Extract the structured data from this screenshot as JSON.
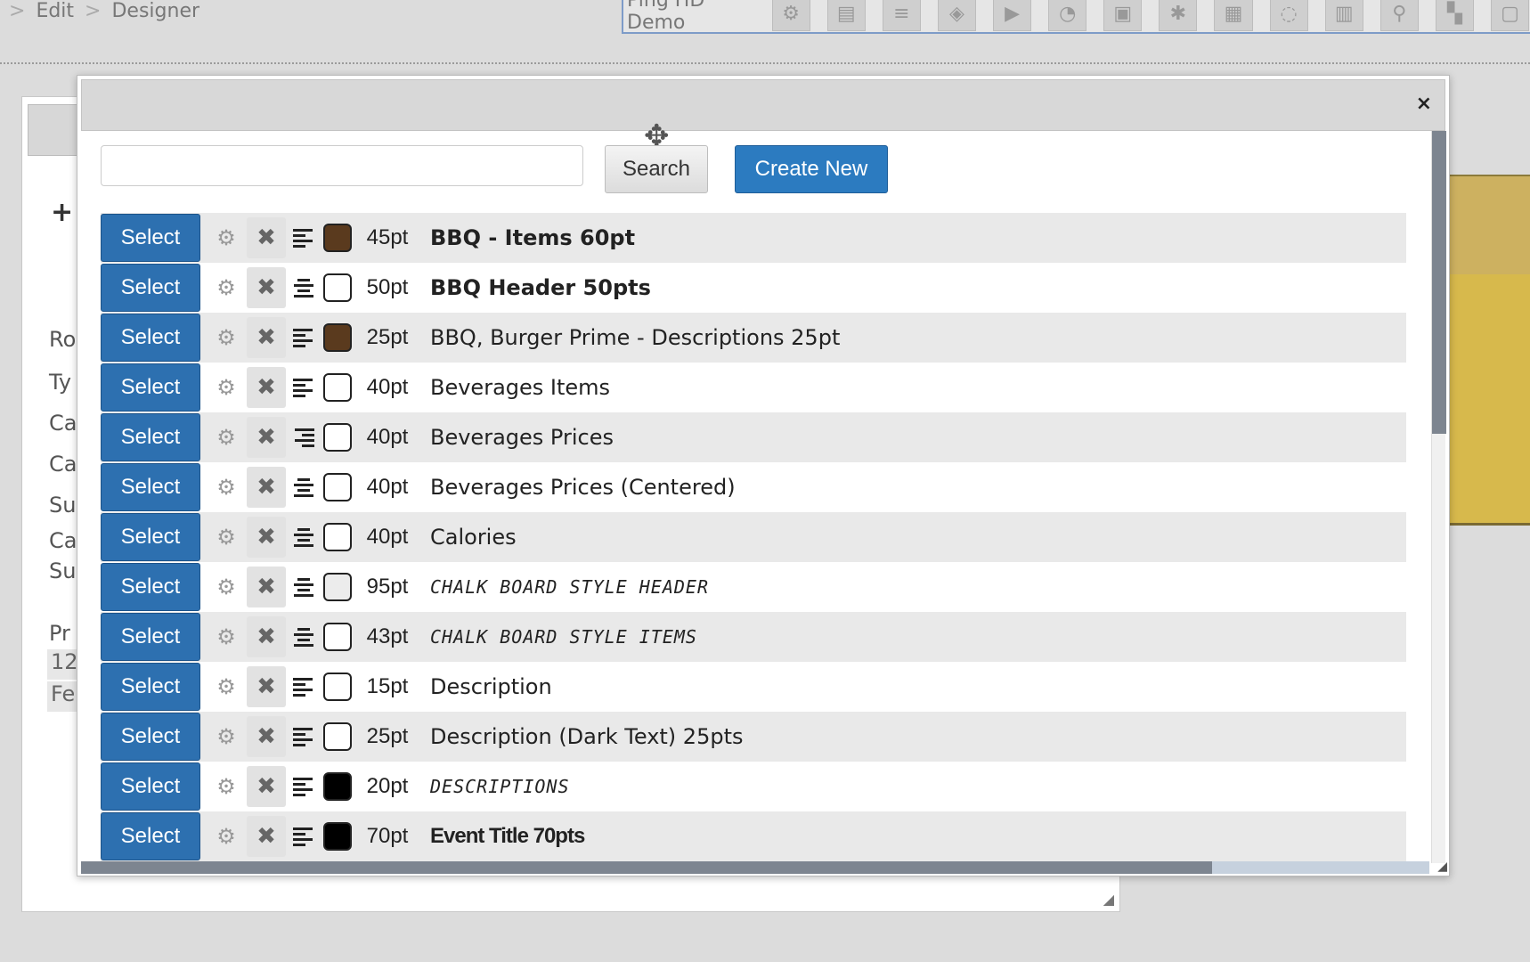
{
  "breadcrumb": {
    "items": [
      "Edit",
      "Designer"
    ],
    "separator": ">"
  },
  "toolbar": {
    "app_name": "Ping HD Demo",
    "icons": [
      "gear-icon",
      "book-icon",
      "database-icon",
      "layers-icon",
      "play-icon",
      "dashboard-icon",
      "frame-icon",
      "bug-icon",
      "calendar-icon",
      "comments-icon",
      "newspaper-icon",
      "map-marker-icon",
      "grid-icon",
      "window-icon"
    ]
  },
  "background_panel": {
    "labels": [
      "Ro",
      "Ty",
      "Ca",
      "Ca",
      "Su",
      "Ca",
      "Su",
      "Pr"
    ],
    "fields": [
      "12",
      "Fe"
    ]
  },
  "modal": {
    "close_label": "×",
    "search": {
      "placeholder": "",
      "button_label": "Search"
    },
    "create_label": "Create New",
    "select_label": "Select",
    "fonts": [
      {
        "size": "45pt",
        "name": "BBQ - Items 60pt",
        "style": "bold",
        "color": "#5a3a1e",
        "align": "left"
      },
      {
        "size": "50pt",
        "name": "BBQ Header 50pts",
        "style": "bold",
        "color": "#ffffff",
        "align": "center"
      },
      {
        "size": "25pt",
        "name": "BBQ, Burger Prime - Descriptions 25pt",
        "style": "normal",
        "color": "#5a3a1e",
        "align": "left"
      },
      {
        "size": "40pt",
        "name": "Beverages Items",
        "style": "normal",
        "color": "#ffffff",
        "align": "left"
      },
      {
        "size": "40pt",
        "name": "Beverages Prices",
        "style": "normal",
        "color": "#ffffff",
        "align": "right"
      },
      {
        "size": "40pt",
        "name": "Beverages Prices (Centered)",
        "style": "normal",
        "color": "#ffffff",
        "align": "center"
      },
      {
        "size": "40pt",
        "name": "Calories",
        "style": "normal",
        "color": "#ffffff",
        "align": "center"
      },
      {
        "size": "95pt",
        "name": "CHALK BOARD STYLE HEADER",
        "style": "chalk",
        "color": "#ececec",
        "align": "center"
      },
      {
        "size": "43pt",
        "name": "CHALK BOARD STYLE ITEMS",
        "style": "chalk",
        "color": "#ffffff",
        "align": "center"
      },
      {
        "size": "15pt",
        "name": "Description",
        "style": "normal",
        "color": "#ffffff",
        "align": "left"
      },
      {
        "size": "25pt",
        "name": "Description (Dark Text) 25pts",
        "style": "normal",
        "color": "#ffffff",
        "align": "left"
      },
      {
        "size": "20pt",
        "name": "DESCRIPTIONS",
        "style": "chalk",
        "color": "#000000",
        "align": "left"
      },
      {
        "size": "70pt",
        "name": "Event Title 70pts",
        "style": "condensed",
        "color": "#000000",
        "align": "left"
      }
    ]
  }
}
